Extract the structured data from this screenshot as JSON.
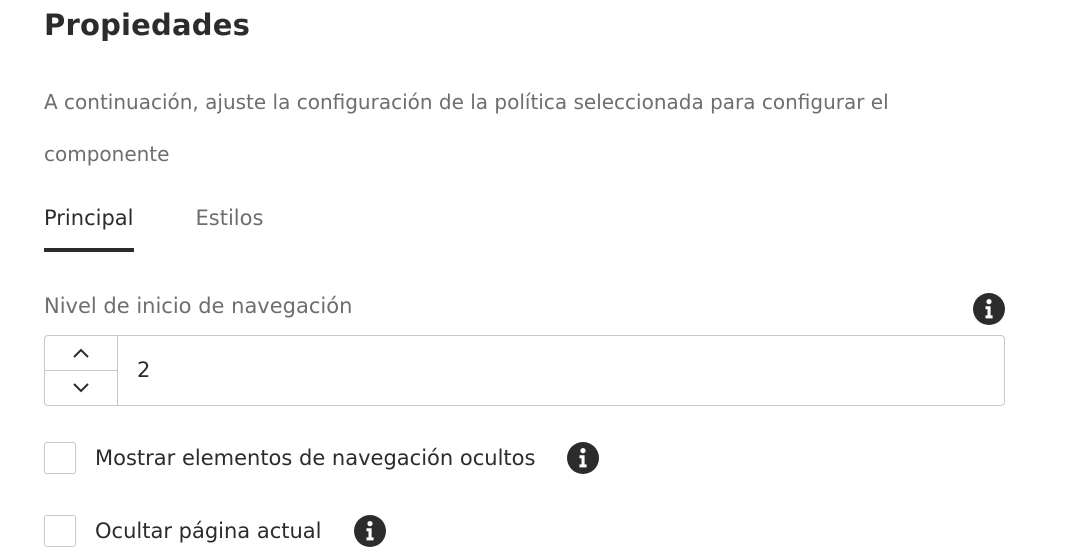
{
  "panel": {
    "title": "Propiedades",
    "description": "A continuación, ajuste la configuración de la política seleccionada para configurar el componente"
  },
  "tabs": [
    {
      "label": "Principal",
      "active": true
    },
    {
      "label": "Estilos",
      "active": false
    }
  ],
  "navigation_start_level": {
    "label": "Nivel de inicio de navegación",
    "value": "2",
    "info_icon": "info-icon"
  },
  "checkboxes": [
    {
      "label": "Mostrar elementos de navegación ocultos",
      "checked": false,
      "info_icon": "info-icon"
    },
    {
      "label": "Ocultar página actual",
      "checked": false,
      "info_icon": "info-icon"
    }
  ],
  "colors": {
    "text_primary": "#2c2c2c",
    "text_secondary": "#6e6e6e",
    "border": "#c8c8c8"
  }
}
